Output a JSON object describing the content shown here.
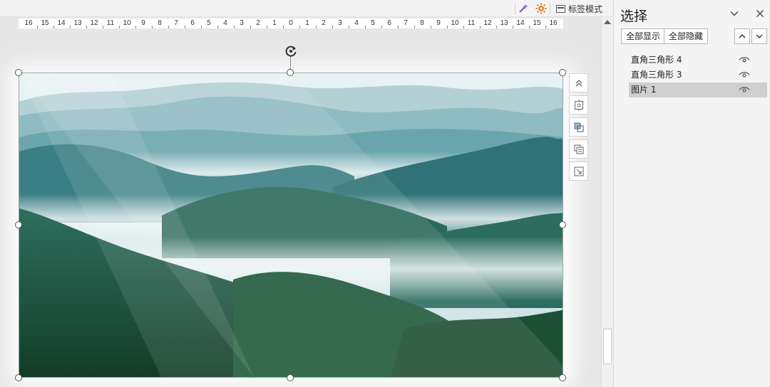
{
  "toolbar": {
    "icons": [
      "magic-wand-icon",
      "sun-settings-icon"
    ],
    "label_mode": "标签模式"
  },
  "ruler": {
    "labels": [
      "16",
      "15",
      "14",
      "13",
      "12",
      "11",
      "10",
      "9",
      "8",
      "7",
      "6",
      "5",
      "4",
      "3",
      "2",
      "1",
      "0",
      "1",
      "2",
      "3",
      "4",
      "5",
      "6",
      "7",
      "8",
      "9",
      "10",
      "11",
      "12",
      "13",
      "14",
      "15",
      "16"
    ]
  },
  "canvas": {
    "image_semantic": "misty-mountain-landscape"
  },
  "selection_pane": {
    "title": "选择",
    "show_all": "全部显示",
    "hide_all": "全部隐藏",
    "items": [
      {
        "label": "直角三角形 4",
        "selected": false
      },
      {
        "label": "直角三角形 3",
        "selected": false
      },
      {
        "label": "图片 1",
        "selected": true
      }
    ]
  },
  "colors": {
    "pane_bg": "#f4f4f4",
    "selected_row": "#cfcfcf",
    "accent_orange": "#e8822a",
    "accent_purple": "#7b52c2"
  }
}
